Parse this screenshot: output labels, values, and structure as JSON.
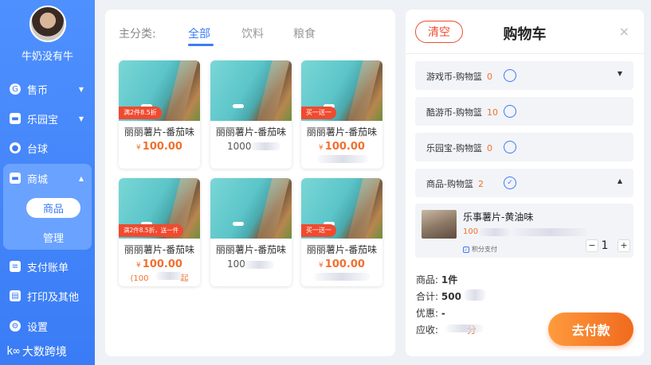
{
  "sidebar": {
    "username": "牛奶没有牛",
    "items": [
      {
        "label": "售币",
        "icon": "coin-icon"
      },
      {
        "label": "乐园宝",
        "icon": "ticket-icon"
      },
      {
        "label": "台球",
        "icon": "billiard-icon"
      },
      {
        "label": "商城",
        "icon": "store-icon"
      }
    ],
    "mall_sub": [
      "商品",
      "管理"
    ],
    "items_after": [
      {
        "label": "支付账单",
        "icon": "bill-icon"
      },
      {
        "label": "打印及其他",
        "icon": "printer-icon"
      },
      {
        "label": "设置",
        "icon": "gear-icon"
      }
    ],
    "brand": "大数跨境"
  },
  "products": {
    "category_label": "主分类:",
    "tabs": [
      "全部",
      "饮料",
      "粮食"
    ],
    "active_tab": "全部",
    "cards": [
      {
        "name": "丽丽薯片-番茄味",
        "price": "100.00",
        "currency": "¥",
        "tag": "满2件8.5折",
        "sub": ""
      },
      {
        "name": "丽丽薯片-番茄味",
        "price": "1000",
        "currency": "",
        "tag": "",
        "sub": ""
      },
      {
        "name": "丽丽薯片-番茄味",
        "price": "100.00",
        "currency": "¥",
        "tag": "买一送一",
        "sub": ""
      },
      {
        "name": "丽丽薯片-番茄味",
        "price": "100.00",
        "currency": "¥",
        "tag": "满2件8.5折，送一件",
        "sub": "(100",
        "sub_suffix": "起"
      },
      {
        "name": "丽丽薯片-番茄味",
        "price": "100",
        "currency": "",
        "tag": "",
        "sub": ""
      },
      {
        "name": "丽丽薯片-番茄味",
        "price": "100.00",
        "currency": "¥",
        "tag": "买一送一",
        "sub": ""
      }
    ]
  },
  "cart": {
    "clear_label": "清空",
    "title": "购物车",
    "close": "×",
    "baskets": [
      {
        "label": "游戏币-购物篮",
        "count": "0",
        "checked": false,
        "caret": "▼"
      },
      {
        "label": "酷游币-购物篮",
        "count": "10",
        "checked": false,
        "caret": ""
      },
      {
        "label": "乐园宝-购物篮",
        "count": "0",
        "checked": false,
        "caret": ""
      },
      {
        "label": "商品-购物篮",
        "count": "2",
        "checked": true,
        "caret": "▲"
      }
    ],
    "item": {
      "name": "乐事薯片-黄油味",
      "price_prefix": "100",
      "points_label": "积分支付",
      "quantity": "1",
      "minus": "−",
      "plus": "+"
    },
    "summary": {
      "goods_label": "商品:",
      "goods_value": "1件",
      "total_label": "合计:",
      "total_value": "500",
      "discount_label": "优惠:",
      "discount_value": "-",
      "due_label": "应收:",
      "due_value": "分"
    },
    "pay_label": "去付款"
  }
}
